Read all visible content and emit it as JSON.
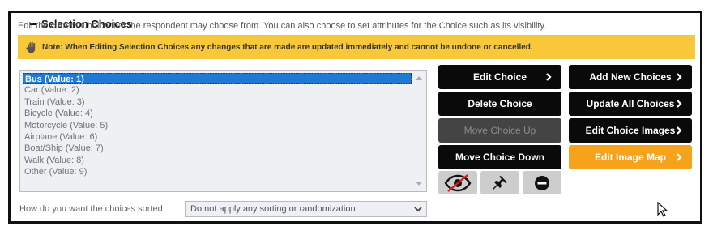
{
  "section": {
    "title": "Selection Choices",
    "description": "Edit the current Choice that the respondent may choose from. You can also choose to set attributes for the Choice such as its visibility.",
    "note": "Note: When Editing Selection Choices any changes that are made are updated immediately and cannot be undone or cancelled."
  },
  "choices": [
    "Bus (Value: 1)",
    "Car (Value: 2)",
    "Train (Value: 3)",
    "Bicycle (Value: 4)",
    "Motorcycle (Value: 5)",
    "Airplane (Value: 6)",
    "Boat/Ship (Value: 7)",
    "Walk (Value: 8)",
    "Other (Value: 9)"
  ],
  "selected_index": 0,
  "buttons": {
    "edit_choice": "Edit Choice",
    "delete_choice": "Delete Choice",
    "move_up": "Move Choice Up",
    "move_down": "Move Choice Down",
    "add_new": "Add New Choices",
    "update_all": "Update All Choices",
    "edit_images": "Edit Choice Images",
    "edit_image_map": "Edit Image Map"
  },
  "icons": {
    "note": "hand-icon",
    "visibility": "eye-slash-icon",
    "pin": "pin-icon",
    "remove": "minus-circle-icon",
    "chevron": "chevron-right-icon"
  },
  "sorting": {
    "label": "How do you want the choices sorted:",
    "selected": "Do not apply any sorting or randomization"
  },
  "colors": {
    "note_bg": "#f8c83a",
    "accent_orange": "#f7a21b",
    "selected_item": "#1e7ad6",
    "button_bg": "#0a0a0a"
  }
}
